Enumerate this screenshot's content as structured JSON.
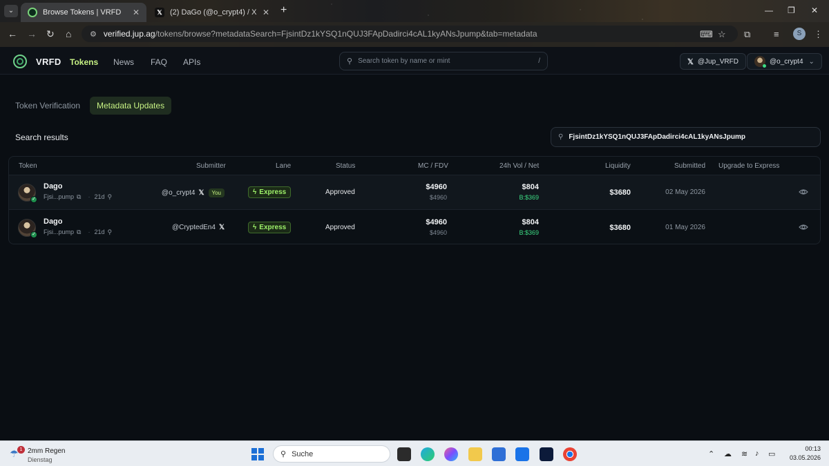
{
  "browser": {
    "tabs": [
      {
        "label": "Browse Tokens | VRFD",
        "active": true
      },
      {
        "label": "(2) DaGo (@o_crypt4) / X",
        "active": false
      }
    ],
    "url_host": "verified.jup.ag",
    "url_path": "/tokens/browse?metadataSearch=FjsintDz1kYSQ1nQUJ3FApDadirci4cAL1kyANsJpump&tab=metadata",
    "profile_initial": "S"
  },
  "site": {
    "brand": "VRFD",
    "nav": [
      "Tokens",
      "News",
      "FAQ",
      "APIs"
    ],
    "search_placeholder": "Search token by name or mint",
    "search_shortcut": "/",
    "twitter_button": "@Jup_VRFD",
    "account_button": "@o_crypt4"
  },
  "tabs": [
    "Token Verification",
    "Metadata Updates"
  ],
  "section_title": "Search results",
  "result_search_value": "FjsintDz1kYSQ1nQUJ3FApDadirci4cAL1kyANsJpump",
  "table": {
    "headers": [
      "Token",
      "Submitter",
      "Lane",
      "Status",
      "MC / FDV",
      "24h Vol / Net",
      "Liquidity",
      "Submitted",
      "Upgrade to Express"
    ],
    "rows": [
      {
        "name": "Dago",
        "mint": "Fjsi...pump",
        "age": "21d",
        "submitter": "@o_crypt4",
        "you": "You",
        "lane": "Express",
        "status": "Approved",
        "mc": "$4960",
        "fdv": "$4960",
        "vol": "$804",
        "net": "B:$369",
        "liquidity": "$3680",
        "submitted": "02 May 2026"
      },
      {
        "name": "Dago",
        "mint": "Fjsi...pump",
        "age": "21d",
        "submitter": "@CryptedEn4",
        "you": "",
        "lane": "Express",
        "status": "Approved",
        "mc": "$4960",
        "fdv": "$4960",
        "vol": "$804",
        "net": "B:$369",
        "liquidity": "$3680",
        "submitted": "01 May 2026"
      }
    ]
  },
  "taskbar": {
    "weather_temp": "2mm Regen",
    "weather_day": "Dienstag",
    "weather_badge": "1",
    "search_label": "Suche",
    "time": "00:13",
    "date": "03.05.2026"
  },
  "colors": {
    "accent": "#c7f284",
    "express": "#9ef26a",
    "net_positive": "#3ddc84",
    "background": "#0a0e13"
  }
}
